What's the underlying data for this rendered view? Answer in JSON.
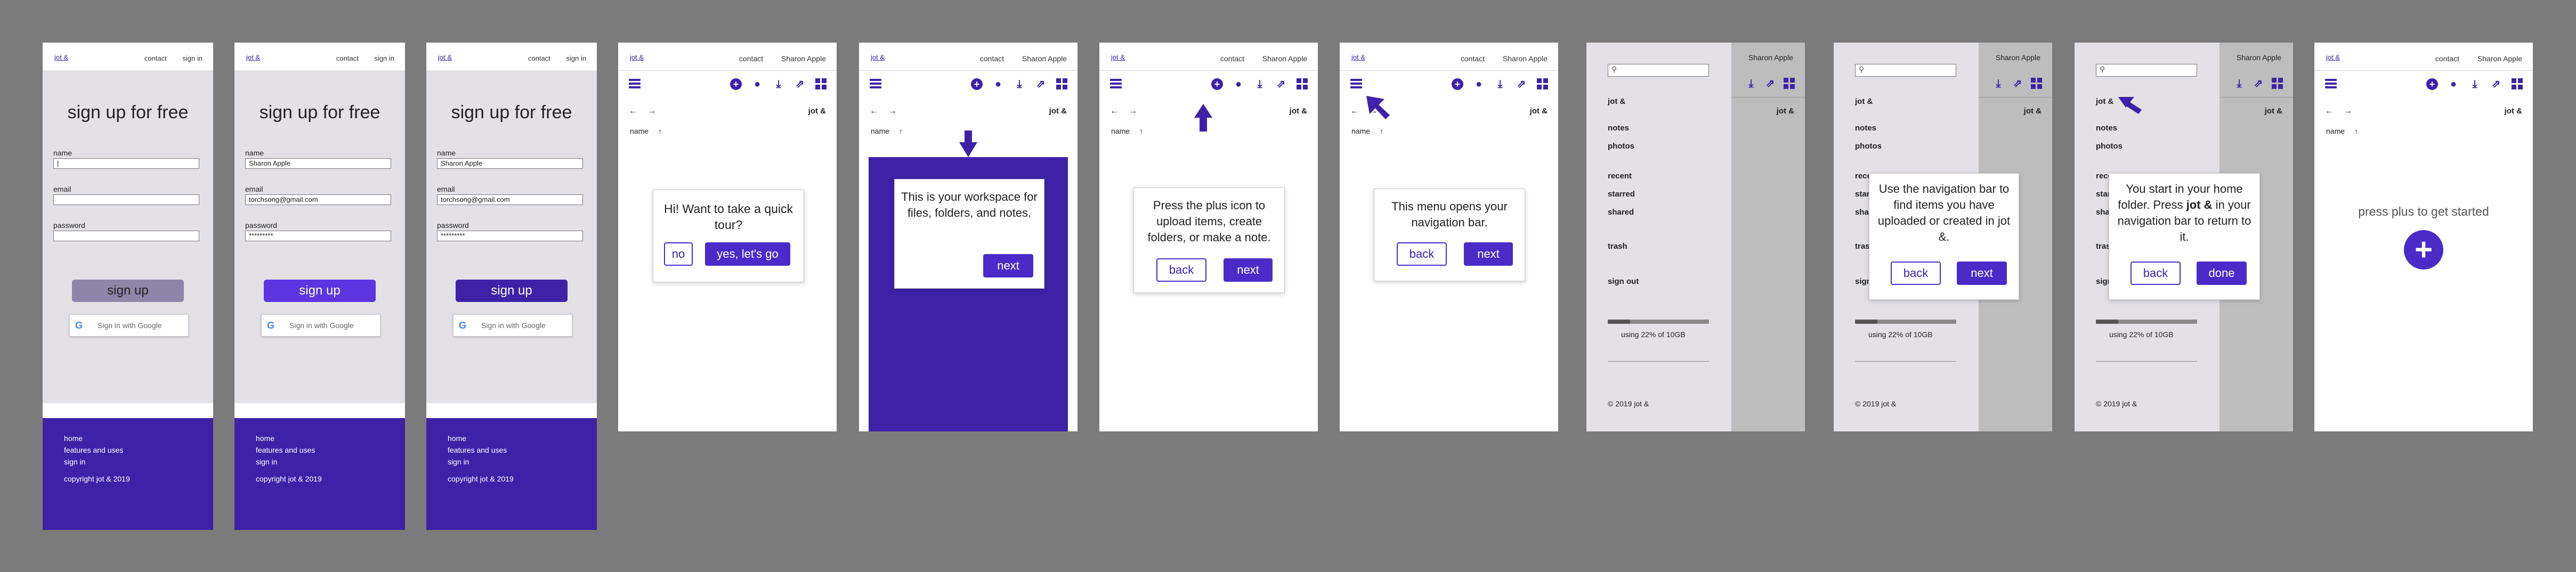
{
  "brand": {
    "logo": "jot &",
    "accent": "#3d22a8",
    "button_accent": "#4a2bc7"
  },
  "signup": {
    "nav_contact": "contact",
    "nav_signin": "sign in",
    "title": "sign up for free",
    "label_name": "name",
    "label_email": "email",
    "label_password": "password",
    "button": "sign up",
    "google": "Sign in with Google",
    "footer_home": "home",
    "footer_features": "features and uses",
    "footer_signin": "sign in",
    "footer_copyright": "copyright jot & 2019",
    "states": [
      {
        "name_value": "|",
        "email_value": "",
        "password_value": "",
        "button_color": "#8d86a8"
      },
      {
        "name_value": "Sharon Apple",
        "email_value": "torchsong@gmail.com",
        "password_value": "*********",
        "button_color": "#5b35e0"
      },
      {
        "name_value": "Sharon Apple",
        "email_value": "torchsong@gmail.com",
        "password_value": "*********",
        "button_color": "#3d22a8"
      }
    ]
  },
  "app": {
    "nav_contact": "contact",
    "user": "Sharon Apple",
    "breadcrumb": "jot &",
    "column_name": "name",
    "back_arrow": "←",
    "forward_arrow": "→",
    "sort_arrow": "↑",
    "icons": [
      "menu-icon",
      "plus-icon",
      "chat-icon",
      "download-icon",
      "share-icon",
      "grid-icon"
    ]
  },
  "tour": {
    "welcome_text": "Hi!  Want to take a quick tour?",
    "no_label": "no",
    "yes_label": "yes, let's go",
    "workspace_text": "This is your workspace for  files, folders, and notes.",
    "next_label": "next",
    "plus_text": "Press the plus icon to upload items, create folders, or make a note.",
    "back_label": "back",
    "menu_text": "This menu opens your navigation bar.",
    "navbar_text": "Use the navigation bar to find items you have uploaded or created in jot &.",
    "home_text_1": "You start in your home folder. Press ",
    "home_text_bold": "jot &",
    "home_text_2": " in your navigation bar to return to it.",
    "done_label": "done"
  },
  "sidebar": {
    "home": "jot &",
    "notes": "notes",
    "photos": "photos",
    "recent": "recent",
    "starred": "starred",
    "shared": "shared",
    "trash": "trash",
    "signout": "sign out",
    "usage_text": "using 22% of 10GB",
    "usage_percent": 22,
    "copyright": "© 2019 jot &"
  },
  "empty": {
    "prompt": "press plus to get started"
  }
}
